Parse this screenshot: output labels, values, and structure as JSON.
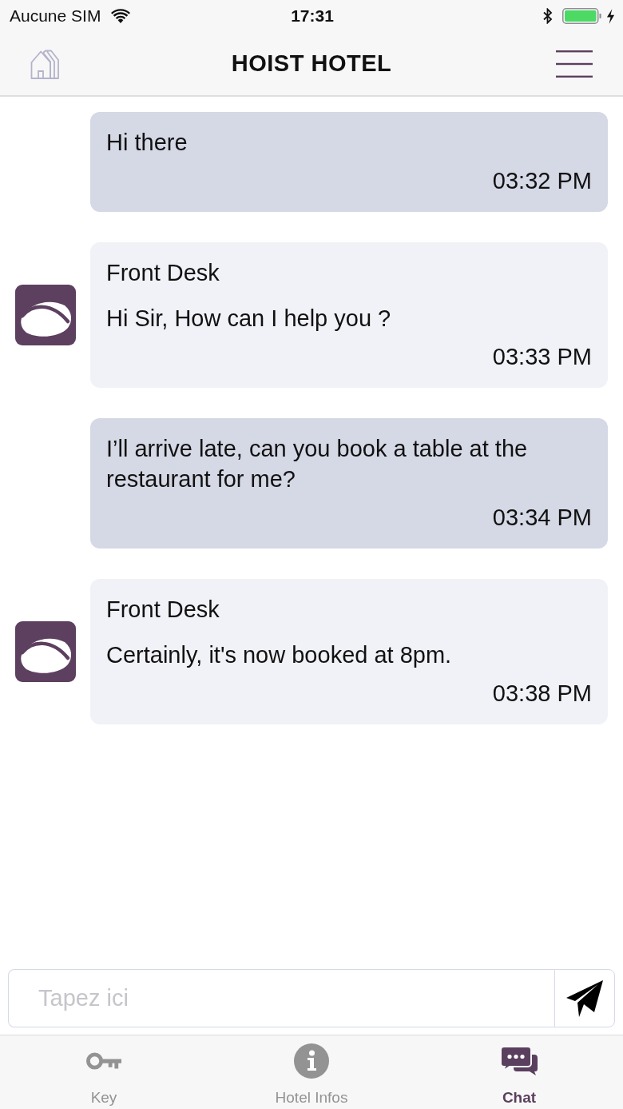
{
  "status_bar": {
    "carrier": "Aucune SIM",
    "time": "17:31"
  },
  "nav_bar": {
    "title": "HOIST HOTEL"
  },
  "messages": [
    {
      "kind": "outgoing",
      "text": "Hi there",
      "time": "03:32 PM"
    },
    {
      "kind": "incoming",
      "sender": "Front Desk",
      "text": "Hi Sir, How can I help you ?",
      "time": "03:33 PM"
    },
    {
      "kind": "outgoing",
      "text": "I’ll arrive late, can you book a table at the restaurant for me?",
      "time": "03:34 PM"
    },
    {
      "kind": "incoming",
      "sender": "Front Desk",
      "text": "Certainly, it's now booked at 8pm.",
      "time": "03:38 PM"
    }
  ],
  "composer": {
    "placeholder": "Tapez ici"
  },
  "tab_bar": [
    {
      "label": "Key",
      "selected": false
    },
    {
      "label": "Hotel Infos",
      "selected": false
    },
    {
      "label": "Chat",
      "selected": true
    }
  ]
}
